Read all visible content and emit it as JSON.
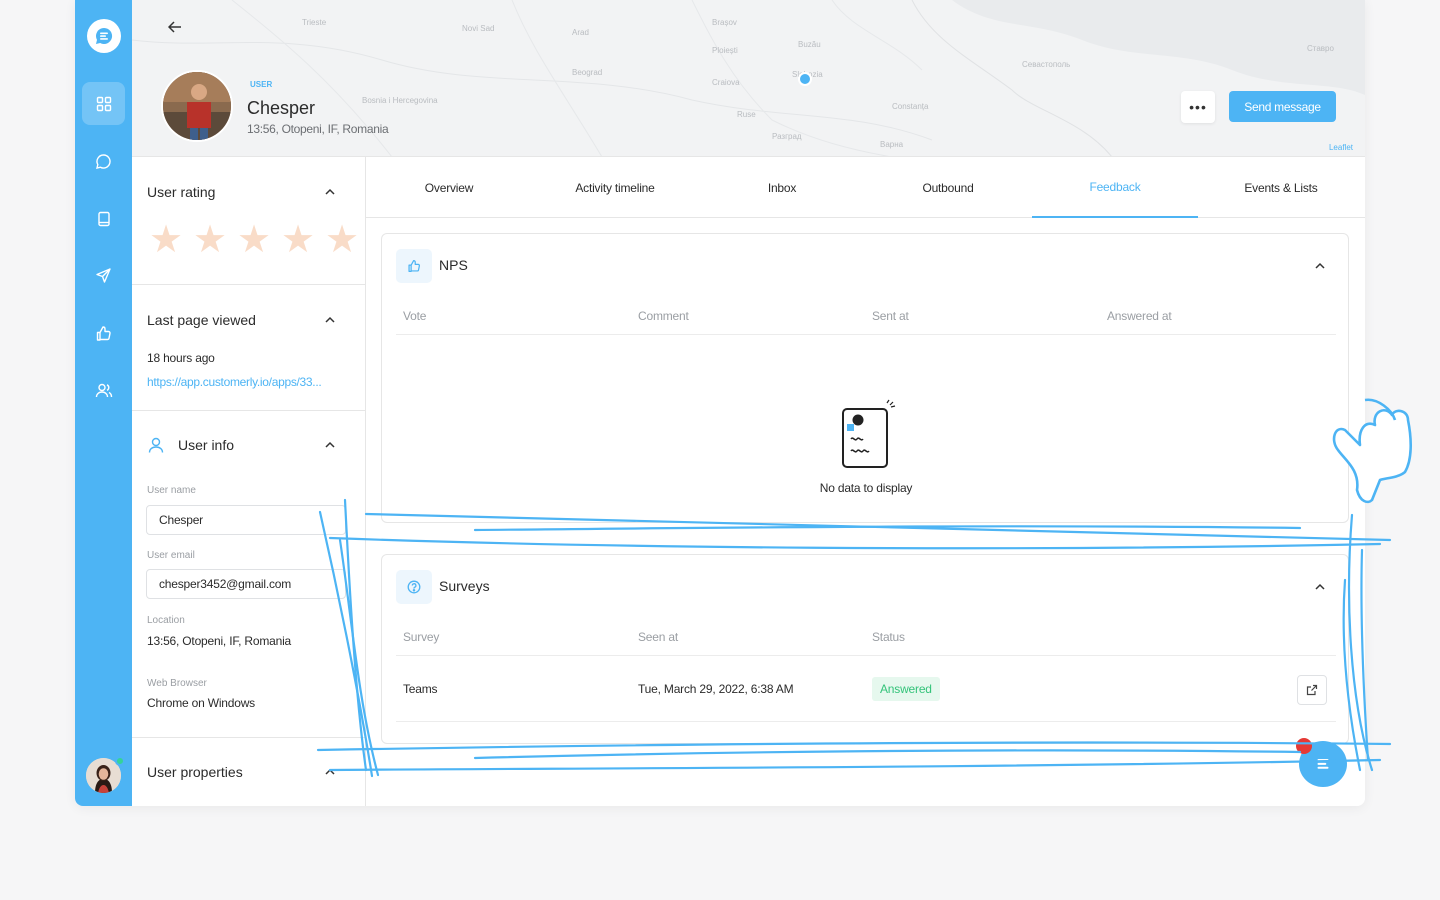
{
  "header": {
    "user_tag": "USER",
    "user_name": "Chesper",
    "user_location": "13:56, Otopeni, IF, Romania",
    "more_label": "•••",
    "send_message_label": "Send message",
    "attribution": "Leaflet"
  },
  "rail": {
    "items": [
      "dashboard-icon",
      "chat-icon",
      "book-icon",
      "send-icon",
      "thumbs-up-icon",
      "users-icon"
    ]
  },
  "side": {
    "rating_title": "User rating",
    "stars": "★",
    "rating_value": 0,
    "rating_max": 5,
    "last_page_title": "Last page viewed",
    "last_page_time": "18 hours ago",
    "last_page_url": "https://app.customerly.io/apps/33...",
    "user_info_title": "User info",
    "user_name_label": "User name",
    "user_name_value": "Chesper",
    "user_email_label": "User email",
    "user_email_value": "chesper3452@gmail.com",
    "location_label": "Location",
    "location_value": "13:56, Otopeni, IF, Romania",
    "browser_label": "Web Browser",
    "browser_value": "Chrome on Windows",
    "user_properties_title": "User properties"
  },
  "tabs": [
    "Overview",
    "Activity timeline",
    "Inbox",
    "Outbound",
    "Feedback",
    "Events & Lists"
  ],
  "active_tab": "Feedback",
  "nps": {
    "title": "NPS",
    "columns": [
      "Vote",
      "Comment",
      "Sent at",
      "Answered at"
    ],
    "empty_text": "No data to display"
  },
  "surveys": {
    "title": "Surveys",
    "columns": [
      "Survey",
      "Seen at",
      "Status"
    ],
    "rows": [
      {
        "survey": "Teams",
        "seen_at": "Tue, March 29, 2022, 6:38 AM",
        "status": "Answered"
      }
    ]
  },
  "colors": {
    "accent": "#4db4f4",
    "success": "#34c37a",
    "star": "#f9dcc8"
  }
}
